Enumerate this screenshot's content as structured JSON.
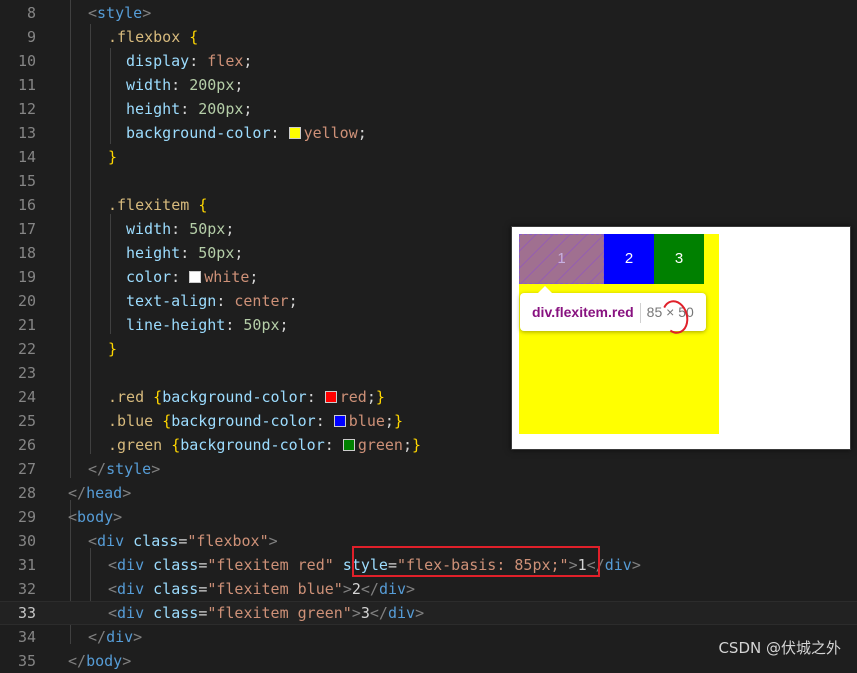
{
  "editor": {
    "lines": [
      {
        "n": "8",
        "indent": 88,
        "tokens": [
          [
            "t-br",
            "<"
          ],
          [
            "t-tag",
            "style"
          ],
          [
            "t-br",
            ">"
          ]
        ]
      },
      {
        "n": "9",
        "indent": 108,
        "tokens": [
          [
            "t-sel",
            ".flexbox "
          ],
          [
            "t-brace",
            "{"
          ]
        ]
      },
      {
        "n": "10",
        "indent": 126,
        "tokens": [
          [
            "t-prop",
            "display"
          ],
          [
            "t-pun",
            ": "
          ],
          [
            "t-val",
            "flex"
          ],
          [
            "t-pun",
            ";"
          ]
        ]
      },
      {
        "n": "11",
        "indent": 126,
        "tokens": [
          [
            "t-prop",
            "width"
          ],
          [
            "t-pun",
            ": "
          ],
          [
            "t-num",
            "200px"
          ],
          [
            "t-pun",
            ";"
          ]
        ]
      },
      {
        "n": "12",
        "indent": 126,
        "tokens": [
          [
            "t-prop",
            "height"
          ],
          [
            "t-pun",
            ": "
          ],
          [
            "t-num",
            "200px"
          ],
          [
            "t-pun",
            ";"
          ]
        ]
      },
      {
        "n": "13",
        "indent": 126,
        "tokens": [
          [
            "t-prop",
            "background-color"
          ],
          [
            "t-pun",
            ": "
          ],
          [
            "swatch",
            "#ffff00"
          ],
          [
            "t-val",
            "yellow"
          ],
          [
            "t-pun",
            ";"
          ]
        ]
      },
      {
        "n": "14",
        "indent": 108,
        "tokens": [
          [
            "t-brace",
            "}"
          ]
        ]
      },
      {
        "n": "15",
        "indent": 108,
        "tokens": []
      },
      {
        "n": "16",
        "indent": 108,
        "tokens": [
          [
            "t-sel",
            ".flexitem "
          ],
          [
            "t-brace",
            "{"
          ]
        ]
      },
      {
        "n": "17",
        "indent": 126,
        "tokens": [
          [
            "t-prop",
            "width"
          ],
          [
            "t-pun",
            ": "
          ],
          [
            "t-num",
            "50px"
          ],
          [
            "t-pun",
            ";"
          ]
        ]
      },
      {
        "n": "18",
        "indent": 126,
        "tokens": [
          [
            "t-prop",
            "height"
          ],
          [
            "t-pun",
            ": "
          ],
          [
            "t-num",
            "50px"
          ],
          [
            "t-pun",
            ";"
          ]
        ]
      },
      {
        "n": "19",
        "indent": 126,
        "tokens": [
          [
            "t-prop",
            "color"
          ],
          [
            "t-pun",
            ": "
          ],
          [
            "swatch",
            "#ffffff"
          ],
          [
            "t-val",
            "white"
          ],
          [
            "t-pun",
            ";"
          ]
        ]
      },
      {
        "n": "20",
        "indent": 126,
        "tokens": [
          [
            "t-prop",
            "text-align"
          ],
          [
            "t-pun",
            ": "
          ],
          [
            "t-val",
            "center"
          ],
          [
            "t-pun",
            ";"
          ]
        ]
      },
      {
        "n": "21",
        "indent": 126,
        "tokens": [
          [
            "t-prop",
            "line-height"
          ],
          [
            "t-pun",
            ": "
          ],
          [
            "t-num",
            "50px"
          ],
          [
            "t-pun",
            ";"
          ]
        ]
      },
      {
        "n": "22",
        "indent": 108,
        "tokens": [
          [
            "t-brace",
            "}"
          ]
        ]
      },
      {
        "n": "23",
        "indent": 108,
        "tokens": []
      },
      {
        "n": "24",
        "indent": 108,
        "tokens": [
          [
            "t-sel",
            ".red "
          ],
          [
            "t-brace",
            "{"
          ],
          [
            "t-prop",
            "background-color"
          ],
          [
            "t-pun",
            ": "
          ],
          [
            "swatch",
            "#ff0000"
          ],
          [
            "t-val",
            "red"
          ],
          [
            "t-pun",
            ";"
          ],
          [
            "t-brace",
            "}"
          ]
        ]
      },
      {
        "n": "25",
        "indent": 108,
        "tokens": [
          [
            "t-sel",
            ".blue "
          ],
          [
            "t-brace",
            "{"
          ],
          [
            "t-prop",
            "background-color"
          ],
          [
            "t-pun",
            ": "
          ],
          [
            "swatch",
            "#0000ff"
          ],
          [
            "t-val",
            "blue"
          ],
          [
            "t-pun",
            ";"
          ],
          [
            "t-brace",
            "}"
          ]
        ]
      },
      {
        "n": "26",
        "indent": 108,
        "tokens": [
          [
            "t-sel",
            ".green "
          ],
          [
            "t-brace",
            "{"
          ],
          [
            "t-prop",
            "background-color"
          ],
          [
            "t-pun",
            ": "
          ],
          [
            "swatch",
            "#008000"
          ],
          [
            "t-val",
            "green"
          ],
          [
            "t-pun",
            ";"
          ],
          [
            "t-brace",
            "}"
          ]
        ]
      },
      {
        "n": "27",
        "indent": 88,
        "tokens": [
          [
            "t-br",
            "</"
          ],
          [
            "t-tag",
            "style"
          ],
          [
            "t-br",
            ">"
          ]
        ]
      },
      {
        "n": "28",
        "indent": 68,
        "tokens": [
          [
            "t-br",
            "</"
          ],
          [
            "t-tag",
            "head"
          ],
          [
            "t-br",
            ">"
          ]
        ]
      },
      {
        "n": "29",
        "indent": 68,
        "tokens": [
          [
            "t-br",
            "<"
          ],
          [
            "t-tag",
            "body"
          ],
          [
            "t-br",
            ">"
          ]
        ]
      },
      {
        "n": "30",
        "indent": 88,
        "tokens": [
          [
            "t-br",
            "<"
          ],
          [
            "t-tag",
            "div"
          ],
          [
            "t-attr",
            " class"
          ],
          [
            "t-pun",
            "="
          ],
          [
            "t-str",
            "\"flexbox\""
          ],
          [
            "t-br",
            ">"
          ]
        ]
      },
      {
        "n": "31",
        "indent": 108,
        "tokens": [
          [
            "t-br",
            "<"
          ],
          [
            "t-tag",
            "div"
          ],
          [
            "t-attr",
            " class"
          ],
          [
            "t-pun",
            "="
          ],
          [
            "t-str",
            "\"flexitem red\""
          ],
          [
            "t-attr",
            " style"
          ],
          [
            "t-pun",
            "="
          ],
          [
            "t-str",
            "\"flex-basis: 85px;\""
          ],
          [
            "t-br",
            ">"
          ],
          [
            "t-txt",
            "1"
          ],
          [
            "t-br",
            "</"
          ],
          [
            "t-tag",
            "div"
          ],
          [
            "t-br",
            ">"
          ]
        ]
      },
      {
        "n": "32",
        "indent": 108,
        "tokens": [
          [
            "t-br",
            "<"
          ],
          [
            "t-tag",
            "div"
          ],
          [
            "t-attr",
            " class"
          ],
          [
            "t-pun",
            "="
          ],
          [
            "t-str",
            "\"flexitem blue\""
          ],
          [
            "t-br",
            ">"
          ],
          [
            "t-txt",
            "2"
          ],
          [
            "t-br",
            "</"
          ],
          [
            "t-tag",
            "div"
          ],
          [
            "t-br",
            ">"
          ]
        ]
      },
      {
        "n": "33",
        "indent": 108,
        "current": true,
        "tokens": [
          [
            "t-br",
            "<"
          ],
          [
            "t-tag",
            "div"
          ],
          [
            "t-attr",
            " class"
          ],
          [
            "t-pun",
            "="
          ],
          [
            "t-str",
            "\"flexitem green\""
          ],
          [
            "t-br",
            ">"
          ],
          [
            "t-txt",
            "3"
          ],
          [
            "t-br",
            "</"
          ],
          [
            "t-tag",
            "div"
          ],
          [
            "t-br",
            ">"
          ]
        ]
      },
      {
        "n": "34",
        "indent": 88,
        "tokens": [
          [
            "t-br",
            "</"
          ],
          [
            "t-tag",
            "div"
          ],
          [
            "t-br",
            ">"
          ]
        ]
      },
      {
        "n": "35",
        "indent": 68,
        "tokens": [
          [
            "t-br",
            "</"
          ],
          [
            "t-tag",
            "body"
          ],
          [
            "t-br",
            ">"
          ]
        ]
      }
    ]
  },
  "preview": {
    "items": [
      {
        "label": "1",
        "class": "red"
      },
      {
        "label": "2",
        "class": "blue"
      },
      {
        "label": "3",
        "class": "green"
      }
    ],
    "tooltip": {
      "name": "div.flexitem.red",
      "dimensions": "85 × 50"
    }
  },
  "watermark": "CSDN @伏城之外",
  "colors": {
    "editor_bg": "#1e1e1e",
    "highlight_red": "#e0202a",
    "flexbox_bg": "#ffff00",
    "blue": "#0000ff",
    "green": "#008000"
  }
}
